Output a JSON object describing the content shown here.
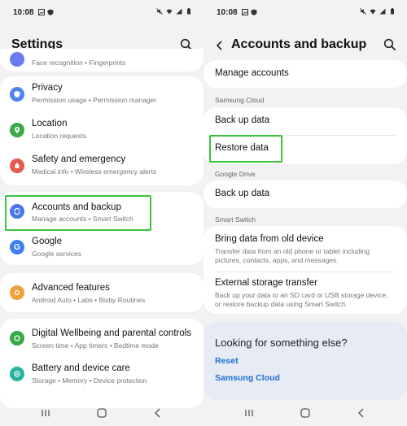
{
  "left": {
    "status": {
      "time": "10:08"
    },
    "title": "Settings",
    "items": [
      {
        "icon": "face-recognition-icon",
        "label": "",
        "sub": "Face recognition  •  Fingerprints",
        "color": "#6a7cf2"
      },
      {
        "icon": "privacy-shield-icon",
        "label": "Privacy",
        "sub": "Permission usage  •  Permission manager",
        "color": "#4f84f0"
      },
      {
        "icon": "location-pin-icon",
        "label": "Location",
        "sub": "Location requests",
        "color": "#39a94a"
      },
      {
        "icon": "emergency-icon",
        "label": "Safety and emergency",
        "sub": "Medical info  •  Wireless emergency alerts",
        "color": "#e45a4f"
      },
      {
        "icon": "sync-icon",
        "label": "Accounts and backup",
        "sub": "Manage accounts  •  Smart Switch",
        "color": "#4a76e8"
      },
      {
        "icon": "google-g-icon",
        "label": "Google",
        "sub": "Google services",
        "color": "#3d7ff0"
      },
      {
        "icon": "advanced-features-icon",
        "label": "Advanced features",
        "sub": "Android Auto  •  Labs  •  Bixby Routines",
        "color": "#f0a23a"
      },
      {
        "icon": "digital-wellbeing-icon",
        "label": "Digital Wellbeing and parental controls",
        "sub": "Screen time  •  App timers  •  Bedtime mode",
        "color": "#38a84a"
      },
      {
        "icon": "battery-care-icon",
        "label": "Battery and device care",
        "sub": "Storage  •  Memory  •  Device protection",
        "color": "#27b39a"
      }
    ]
  },
  "right": {
    "status": {
      "time": "10:08"
    },
    "title": "Accounts and backup",
    "manage_accounts": "Manage accounts",
    "section_samsung": "Samsung Cloud",
    "backup_1": "Back up data",
    "restore": "Restore data",
    "section_google": "Google Drive",
    "backup_2": "Back up data",
    "section_smart": "Smart Switch",
    "bring_title": "Bring data from old device",
    "bring_sub": "Transfer data from an old phone or tablet including pictures, contacts, apps, and messages.",
    "ext_title": "External storage transfer",
    "ext_sub": "Back up your data to an SD card or USB storage device, or restore backup data using Smart Switch.",
    "looking_title": "Looking for something else?",
    "link_reset": "Reset",
    "link_cloud": "Samsung Cloud"
  },
  "colors": {
    "highlight": "#3bc43b",
    "link": "#1b6fd1"
  }
}
